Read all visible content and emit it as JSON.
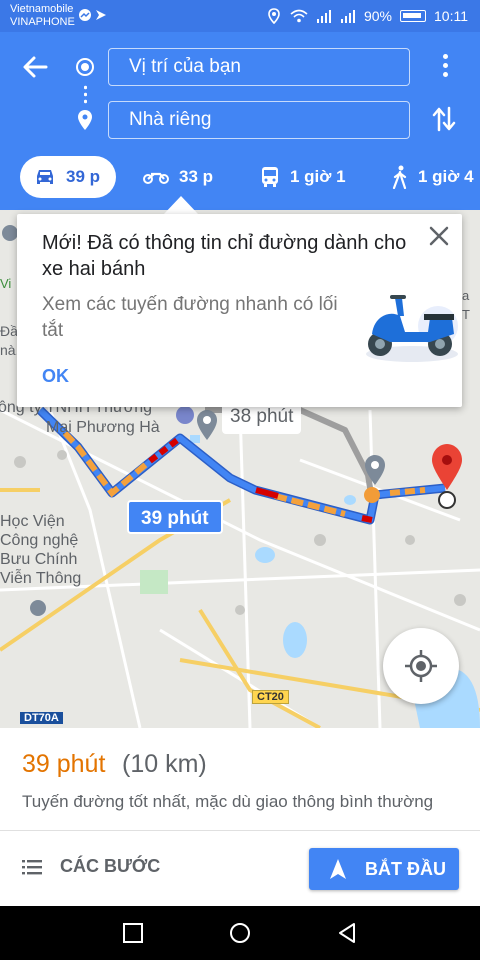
{
  "status_bar": {
    "carrier_1": "Vietnamobile",
    "carrier_2": "VINAPHONE",
    "battery": "90%",
    "time": "10:11"
  },
  "search": {
    "origin": "Vị trí của bạn",
    "destination": "Nhà riêng"
  },
  "modes": {
    "car": "39 p",
    "motorbike": "33 p",
    "transit": "1 giờ 1",
    "walk": "1 giờ 4"
  },
  "tooltip": {
    "title": "Mới! Đã có thông tin chỉ đường dành cho xe hai bánh",
    "body": "Xem các tuyến đường nhanh có lối tắt",
    "ok": "OK"
  },
  "map": {
    "route_time": "39 phút",
    "alt_route_time": "38 phút",
    "labels": {
      "place_1a": "ông ty TNHH Thương",
      "place_1b": "Mại Phương Hà",
      "place_2": "Học Viện\nCông nghệ\nBưu Chính\nViễn Thông",
      "edge_1": "Đầu\nnà.",
      "edge_2": "Vi",
      "edge_3": "a T"
    },
    "road_tags": {
      "ct20": "CT20",
      "dt70a": "DT70A"
    }
  },
  "summary": {
    "eta": "39 phút",
    "distance": "(10 km)",
    "description": "Tuyến đường tốt nhất, mặc dù giao thông bình thường",
    "steps_label": "CÁC BƯỚC",
    "start_label": "BẮT ĐẦU"
  },
  "colors": {
    "header_blue": "#4285f4",
    "status_blue": "#3b78e7",
    "eta_orange": "#e37400",
    "route_blue": "#4285f4",
    "traffic_orange": "#f4a13c",
    "traffic_red": "#d50000",
    "pin_red": "#ea4335"
  },
  "icons": {
    "back": "arrow-left-icon",
    "origin": "origin-dot-icon",
    "destination": "place-pin-icon",
    "menu": "more-vert-icon",
    "swap": "swap-vert-icon",
    "car": "car-icon",
    "motorbike": "motorbike-icon",
    "transit": "bus-icon",
    "walk": "walk-icon",
    "close": "close-icon",
    "locate": "my-location-icon",
    "steps": "list-icon",
    "navigate": "navigation-arrow-icon"
  }
}
